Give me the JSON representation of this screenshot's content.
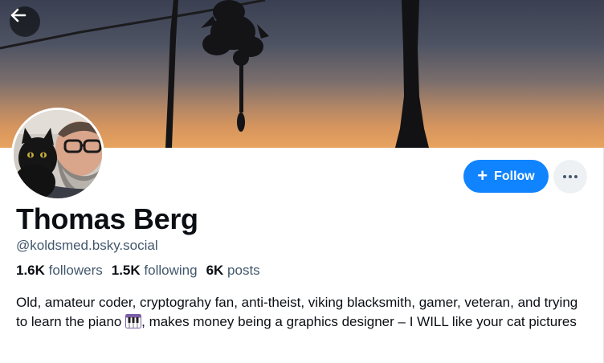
{
  "profile": {
    "display_name": "Thomas Berg",
    "handle": "@koldsmed.bsky.social",
    "stats": {
      "followers_count": "1.6K",
      "followers_label": "followers",
      "following_count": "1.5K",
      "following_label": "following",
      "posts_count": "6K",
      "posts_label": "posts"
    },
    "bio_part1": "Old, amateur coder, cryptograhy fan, anti-theist, viking blacksmith, gamer, veteran, and trying to learn the piano",
    "bio_part2": ", makes money being a graphics designer – I WILL like your cat pictures"
  },
  "actions": {
    "follow_label": "Follow",
    "follow_icon": "plus-icon",
    "more_icon": "ellipsis-icon",
    "back_icon": "arrow-left-icon"
  },
  "colors": {
    "accent": "#1083fe",
    "muted_text": "#42576c",
    "text": "#0b0f14"
  }
}
